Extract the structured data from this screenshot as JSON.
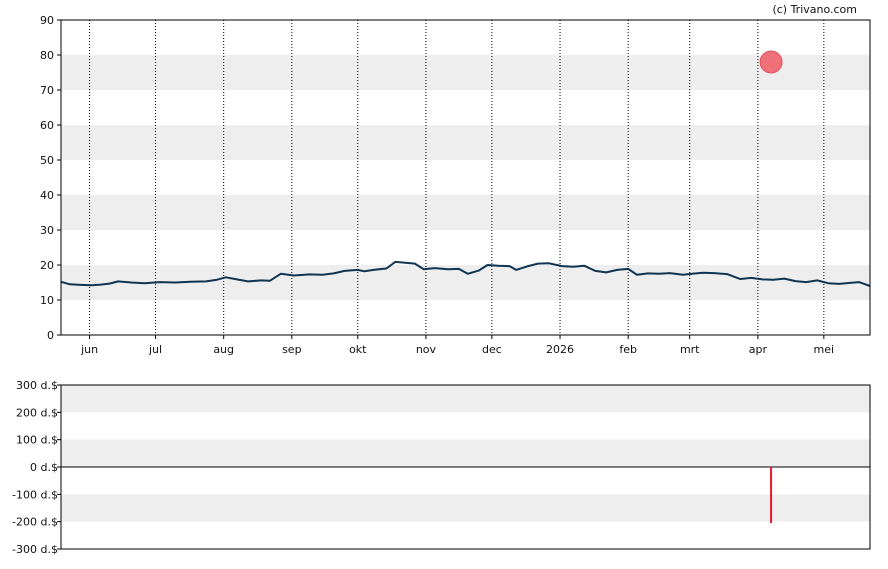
{
  "credit": "(c) Trivano.com",
  "colors": {
    "line": "#0f3553",
    "marker": "#f0707a",
    "bar": "#e8192c",
    "band": "#eeeeee",
    "frame": "#000000"
  },
  "chart_data": [
    {
      "type": "line",
      "title": "",
      "ylim": [
        0,
        90
      ],
      "yticks": [
        0,
        10,
        20,
        30,
        40,
        50,
        60,
        70,
        80,
        90
      ],
      "ytick_labels": [
        "0",
        "10",
        "20",
        "30",
        "40",
        "50",
        "60",
        "70",
        "80",
        "90"
      ],
      "xlim": [
        "2025-05-19",
        "2026-05-22"
      ],
      "xticks": [
        {
          "date": "2025-06-01",
          "label": "jun"
        },
        {
          "date": "2025-07-01",
          "label": "jul"
        },
        {
          "date": "2025-08-01",
          "label": "aug"
        },
        {
          "date": "2025-09-01",
          "label": "sep"
        },
        {
          "date": "2025-10-01",
          "label": "okt"
        },
        {
          "date": "2025-11-01",
          "label": "nov"
        },
        {
          "date": "2025-12-01",
          "label": "dec"
        },
        {
          "date": "2026-01-01",
          "label": "2026"
        },
        {
          "date": "2026-02-01",
          "label": "feb"
        },
        {
          "date": "2026-03-01",
          "label": "mrt"
        },
        {
          "date": "2026-04-01",
          "label": "apr"
        },
        {
          "date": "2026-05-01",
          "label": "mei"
        }
      ],
      "grid": "vertical dotted at month ticks, horizontal alternating bands",
      "series": [
        {
          "points": [
            [
              "2025-05-19",
              15.2
            ],
            [
              "2025-05-23",
              14.5
            ],
            [
              "2025-05-28",
              14.3
            ],
            [
              "2025-06-02",
              14.2
            ],
            [
              "2025-06-06",
              14.4
            ],
            [
              "2025-06-10",
              14.7
            ],
            [
              "2025-06-14",
              15.3
            ],
            [
              "2025-06-20",
              15.0
            ],
            [
              "2025-06-26",
              14.8
            ],
            [
              "2025-07-03",
              15.1
            ],
            [
              "2025-07-10",
              15.0
            ],
            [
              "2025-07-17",
              15.2
            ],
            [
              "2025-07-24",
              15.3
            ],
            [
              "2025-07-29",
              15.8
            ],
            [
              "2025-08-02",
              16.5
            ],
            [
              "2025-08-07",
              15.9
            ],
            [
              "2025-08-12",
              15.3
            ],
            [
              "2025-08-18",
              15.6
            ],
            [
              "2025-08-22",
              15.5
            ],
            [
              "2025-08-27",
              17.5
            ],
            [
              "2025-09-02",
              17.0
            ],
            [
              "2025-09-09",
              17.3
            ],
            [
              "2025-09-15",
              17.2
            ],
            [
              "2025-09-20",
              17.6
            ],
            [
              "2025-09-25",
              18.3
            ],
            [
              "2025-10-01",
              18.6
            ],
            [
              "2025-10-04",
              18.2
            ],
            [
              "2025-10-09",
              18.7
            ],
            [
              "2025-10-14",
              19.0
            ],
            [
              "2025-10-18",
              20.9
            ],
            [
              "2025-10-22",
              20.7
            ],
            [
              "2025-10-27",
              20.4
            ],
            [
              "2025-10-31",
              18.8
            ],
            [
              "2025-11-05",
              19.1
            ],
            [
              "2025-11-11",
              18.8
            ],
            [
              "2025-11-16",
              18.9
            ],
            [
              "2025-11-20",
              17.5
            ],
            [
              "2025-11-25",
              18.4
            ],
            [
              "2025-11-29",
              20.0
            ],
            [
              "2025-12-04",
              19.8
            ],
            [
              "2025-12-09",
              19.7
            ],
            [
              "2025-12-12",
              18.6
            ],
            [
              "2025-12-17",
              19.6
            ],
            [
              "2025-12-22",
              20.4
            ],
            [
              "2025-12-27",
              20.5
            ],
            [
              "2026-01-02",
              19.7
            ],
            [
              "2026-01-07",
              19.5
            ],
            [
              "2026-01-12",
              19.8
            ],
            [
              "2026-01-17",
              18.3
            ],
            [
              "2026-01-22",
              17.9
            ],
            [
              "2026-01-27",
              18.6
            ],
            [
              "2026-02-01",
              18.9
            ],
            [
              "2026-02-05",
              17.2
            ],
            [
              "2026-02-10",
              17.6
            ],
            [
              "2026-02-15",
              17.5
            ],
            [
              "2026-02-20",
              17.7
            ],
            [
              "2026-02-26",
              17.2
            ],
            [
              "2026-03-02",
              17.5
            ],
            [
              "2026-03-07",
              17.8
            ],
            [
              "2026-03-12",
              17.7
            ],
            [
              "2026-03-18",
              17.4
            ],
            [
              "2026-03-24",
              16.0
            ],
            [
              "2026-03-29",
              16.3
            ],
            [
              "2026-04-03",
              15.9
            ],
            [
              "2026-04-08",
              15.8
            ],
            [
              "2026-04-13",
              16.1
            ],
            [
              "2026-04-18",
              15.4
            ],
            [
              "2026-04-23",
              15.1
            ],
            [
              "2026-04-28",
              15.6
            ],
            [
              "2026-05-03",
              14.8
            ],
            [
              "2026-05-08",
              14.6
            ],
            [
              "2026-05-13",
              14.9
            ],
            [
              "2026-05-17",
              15.1
            ],
            [
              "2026-05-22",
              14.0
            ]
          ]
        }
      ],
      "markers": [
        {
          "date": "2026-04-07",
          "value": 78
        }
      ]
    },
    {
      "type": "bar",
      "title": "",
      "ylim": [
        -300,
        300
      ],
      "yticks": [
        300,
        200,
        100,
        0,
        -100,
        -200,
        -300
      ],
      "ytick_labels": [
        "300 d.$",
        "200 d.$",
        "100 d.$",
        "0 d.$",
        "-100 d.$",
        "-200 d.$",
        "-300 d.$"
      ],
      "xlim": [
        "2025-05-19",
        "2026-05-22"
      ],
      "grid": "horizontal alternating bands",
      "bars": [
        {
          "date": "2026-04-07",
          "value": -205
        }
      ]
    }
  ]
}
